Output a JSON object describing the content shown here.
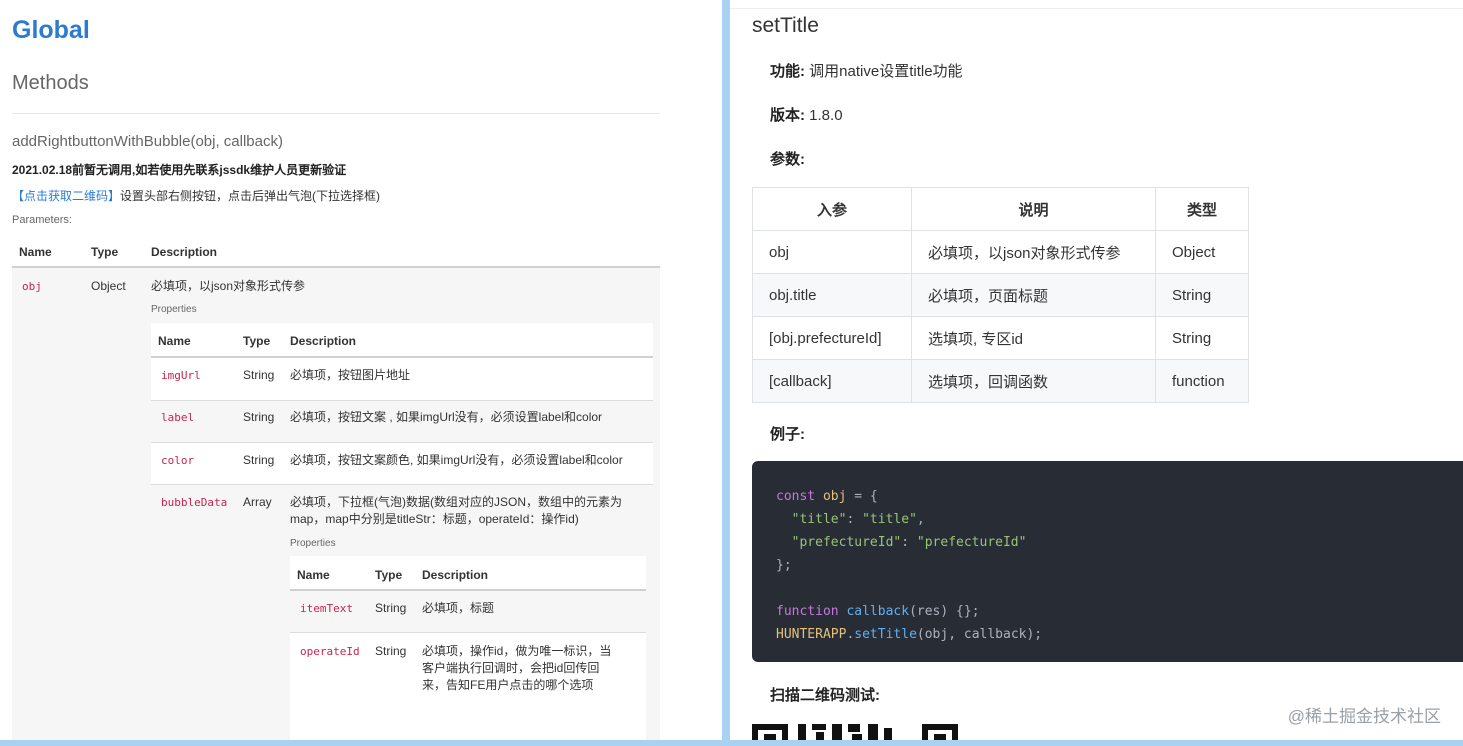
{
  "left": {
    "title": "Global",
    "section": "Methods",
    "signature": "addRightbuttonWithBubble(obj, callback)",
    "note": "2021.02.18前暂无调用,如若使用先联系jssdk维护人员更新验证",
    "link_text": "【点击获取二维码】",
    "description": "设置头部右侧按钮，点击后弹出气泡(下拉选择框)",
    "params_label": "Parameters:",
    "headers": [
      "Name",
      "Type",
      "Description"
    ],
    "obj_row": {
      "name": "obj",
      "type": "Object",
      "desc": "必填项，以json对象形式传参"
    },
    "properties_label": "Properties",
    "rows": [
      {
        "name": "imgUrl",
        "type": "String",
        "desc": "必填项，按钮图片地址"
      },
      {
        "name": "label",
        "type": "String",
        "desc": "必填项，按钮文案 , 如果imgUrl没有，必须设置label和color"
      },
      {
        "name": "color",
        "type": "String",
        "desc": "必填项，按钮文案颜色, 如果imgUrl没有，必须设置label和color"
      },
      {
        "name": "bubbleData",
        "type": "Array",
        "desc1": "必填项，下拉框(气泡)数据(数组对应的JSON，数组中的元素为",
        "desc2": "map，map中分别是titleStr：标题，operateId：操作id)"
      }
    ],
    "sub_rows": [
      {
        "name": "itemText",
        "type": "String",
        "desc": "必填项，标题"
      },
      {
        "name": "operateId",
        "type": "String",
        "desc1": "必填项，操作id，做为唯一标识，当",
        "desc2": "客户端执行回调时，会把id回传回",
        "desc3": "来，告知FE用户点击的哪个选项"
      }
    ]
  },
  "right": {
    "title": "setTitle",
    "feature_label": "功能:",
    "feature_value": "调用native设置title功能",
    "version_label": "版本:",
    "version_value": "1.8.0",
    "params_label": "参数:",
    "table_headers": [
      "入参",
      "说明",
      "类型"
    ],
    "table_rows": [
      [
        "obj",
        "必填项，以json对象形式传参",
        "Object"
      ],
      [
        "obj.title",
        "必填项，页面标题",
        "String"
      ],
      [
        "[obj.prefectureId]",
        "选填项, 专区id",
        "String"
      ],
      [
        "[callback]",
        "选填项，回调函数",
        "function"
      ]
    ],
    "example_label": "例子:",
    "code": {
      "kw_const": "const",
      "var_obj": "obj",
      "eq_brace": " = {",
      "key_title": "\"title\"",
      "val_title": "\"title\"",
      "key_pref": "\"prefectureId\"",
      "val_pref": "\"prefectureId\"",
      "close": "};",
      "kw_function": "function",
      "fn_name": "callback",
      "fn_rest": "(res) {};",
      "obj_app": "HUNTERAPP",
      "method": "setTitle",
      "call_rest": "(obj, callback);"
    },
    "scan_label": "扫描二维码测试:",
    "watermark": "@稀土掘金技术社区"
  }
}
